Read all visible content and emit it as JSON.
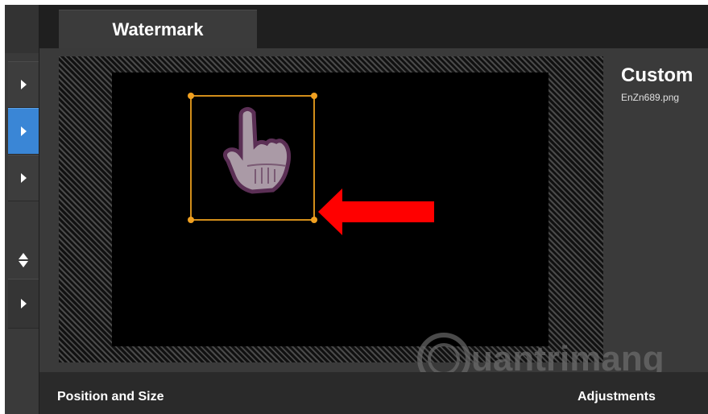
{
  "tab": {
    "label": "Watermark"
  },
  "info": {
    "title": "Custom",
    "filename": "EnZn689.png"
  },
  "sections": {
    "position_label": "Position and Size",
    "adjustments_label": "Adjustments"
  },
  "overlay": {
    "text": "uantrimang"
  },
  "colors": {
    "accent": "#3a86d6",
    "selection": "#d28e1a",
    "arrow": "#ff0000"
  },
  "icons": {
    "watermark": "pointing-hand-icon",
    "annotation": "left-arrow-icon",
    "logo": "lightbulb-icon"
  }
}
